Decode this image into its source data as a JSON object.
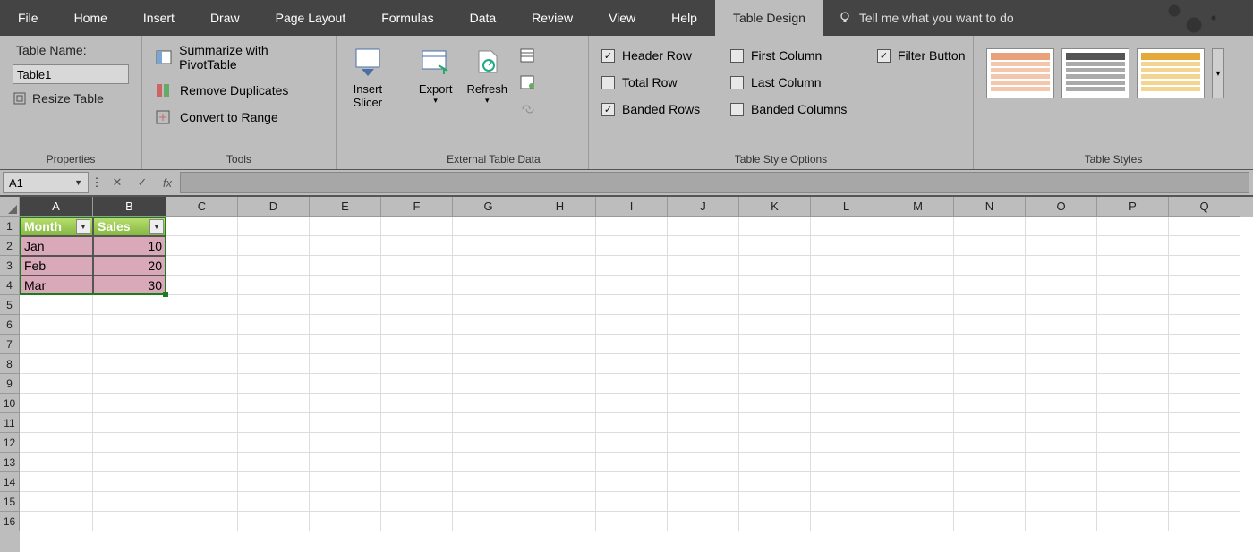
{
  "tabs": [
    "File",
    "Home",
    "Insert",
    "Draw",
    "Page Layout",
    "Formulas",
    "Data",
    "Review",
    "View",
    "Help",
    "Table Design"
  ],
  "active_tab": "Table Design",
  "tellme": "Tell me what you want to do",
  "ribbon": {
    "properties": {
      "label": "Properties",
      "table_name_label": "Table Name:",
      "table_name_value": "Table1",
      "resize": "Resize Table"
    },
    "tools": {
      "label": "Tools",
      "pivot": "Summarize with PivotTable",
      "dedupe": "Remove Duplicates",
      "range": "Convert to Range"
    },
    "slicer": {
      "label1": "Insert",
      "label2": "Slicer"
    },
    "external": {
      "label": "External Table Data",
      "export": "Export",
      "refresh": "Refresh"
    },
    "styleopts": {
      "label": "Table Style Options",
      "header_row": "Header Row",
      "total_row": "Total Row",
      "banded_rows": "Banded Rows",
      "first_col": "First Column",
      "last_col": "Last Column",
      "banded_cols": "Banded Columns",
      "filter_btn": "Filter Button"
    },
    "styles": {
      "label": "Table Styles"
    }
  },
  "namebox": "A1",
  "columns": [
    "A",
    "B",
    "C",
    "D",
    "E",
    "F",
    "G",
    "H",
    "I",
    "J",
    "K",
    "L",
    "M",
    "N",
    "O",
    "P",
    "Q"
  ],
  "rows": [
    1,
    2,
    3,
    4,
    5,
    6,
    7,
    8,
    9,
    10,
    11,
    12,
    13,
    14,
    15,
    16
  ],
  "table": {
    "headers": [
      "Month",
      "Sales"
    ],
    "data": [
      [
        "Jan",
        10
      ],
      [
        "Feb",
        20
      ],
      [
        "Mar",
        30
      ]
    ]
  }
}
